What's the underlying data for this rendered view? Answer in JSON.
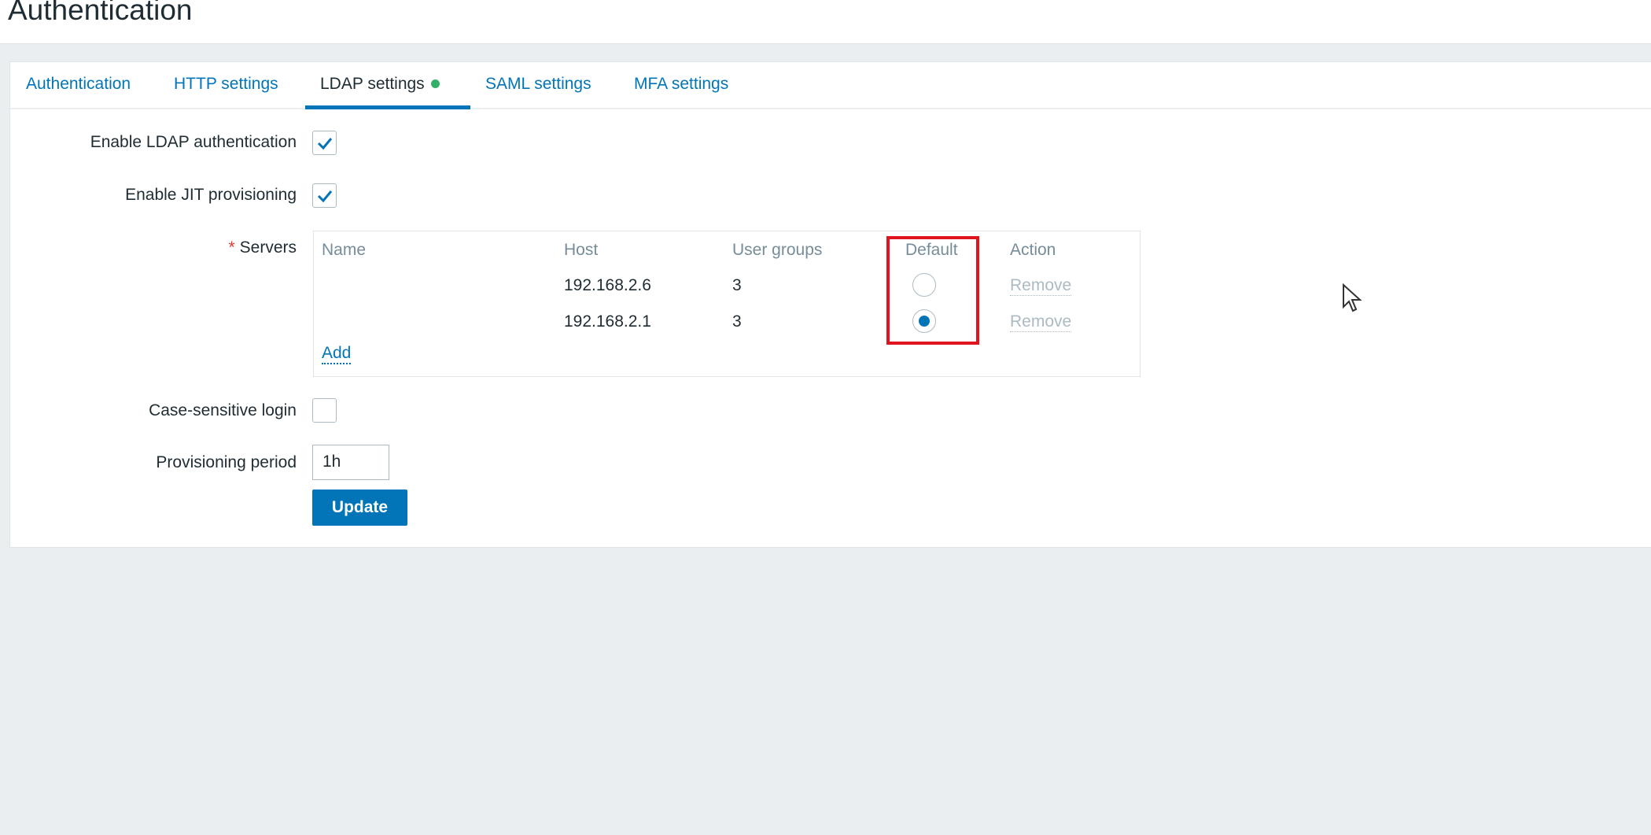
{
  "page_title": "Authentication",
  "tabs": [
    {
      "label": "Authentication"
    },
    {
      "label": "HTTP settings"
    },
    {
      "label": "LDAP settings",
      "active": true
    },
    {
      "label": "SAML settings"
    },
    {
      "label": "MFA settings"
    }
  ],
  "form": {
    "enable_ldap_label": "Enable LDAP authentication",
    "enable_ldap": true,
    "enable_jit_label": "Enable JIT provisioning",
    "enable_jit": true,
    "servers_label": "Servers",
    "required_mark": "*",
    "servers": {
      "columns": [
        "Name",
        "Host",
        "User groups",
        "Default",
        "Action"
      ],
      "rows": [
        {
          "name": "",
          "host": "192.168.2.6",
          "user_groups": "3",
          "default": false,
          "action": "Remove"
        },
        {
          "name": "",
          "host": "192.168.2.1",
          "user_groups": "3",
          "default": true,
          "action": "Remove"
        }
      ],
      "add_label": "Add"
    },
    "case_sensitive_label": "Case-sensitive login",
    "case_sensitive": false,
    "provisioning_period_label": "Provisioning period",
    "provisioning_period": "1h",
    "update_label": "Update"
  },
  "colors": {
    "accent": "#0275b8",
    "highlight": "#e0141e",
    "status_dot": "#34af67"
  }
}
